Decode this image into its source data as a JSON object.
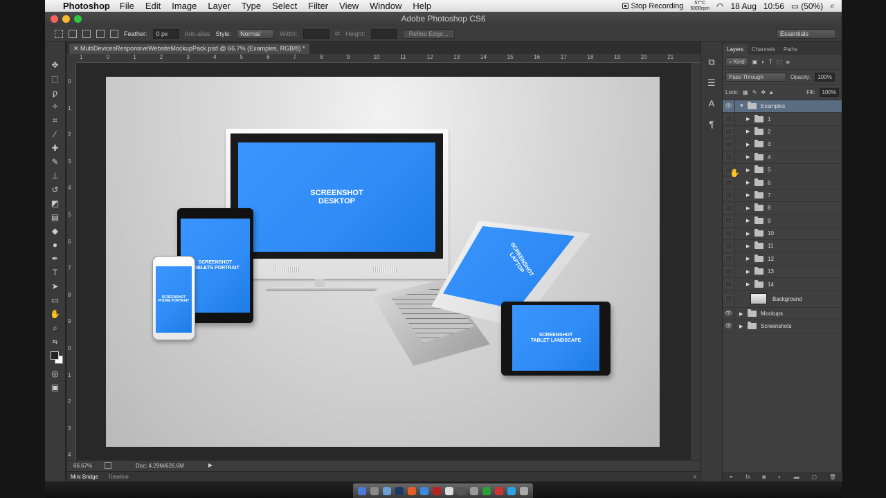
{
  "menubar": {
    "app_name": "Photoshop",
    "menus": [
      "File",
      "Edit",
      "Image",
      "Layer",
      "Type",
      "Select",
      "Filter",
      "View",
      "Window",
      "Help"
    ],
    "stop_recording": "Stop Recording",
    "temp_line1": "57°C",
    "temp_line2": "5000rpm",
    "date": "18 Aug",
    "time": "10:56",
    "battery": "(50%)"
  },
  "window": {
    "title": "Adobe Photoshop CS6"
  },
  "options_bar": {
    "feather_label": "Feather:",
    "feather_value": "0 px",
    "antialias_label": "Anti-alias",
    "style_label": "Style:",
    "style_value": "Normal",
    "width_label": "Width:",
    "height_label": "Height:",
    "refine_edge": "Refine Edge...",
    "workspace": "Essentials"
  },
  "document": {
    "tab_title": "MultiDevicesResponsiveWebsiteMockupPack.psd @ 66.7% (Examples, RGB/8) *",
    "ruler_top_labels": [
      "1",
      "0",
      "1",
      "2",
      "3",
      "4",
      "5",
      "6",
      "7",
      "8",
      "9",
      "10",
      "11",
      "12",
      "13",
      "14",
      "15",
      "16",
      "17",
      "18",
      "19",
      "20",
      "21"
    ],
    "ruler_left_labels": [
      "0",
      "1",
      "2",
      "3",
      "4",
      "5",
      "6",
      "7",
      "8",
      "9",
      "0",
      "1",
      "2",
      "3",
      "4"
    ]
  },
  "mockup": {
    "desktop_line1": "SCREENSHOT",
    "desktop_line2": "DESKTOP",
    "tablet_portrait_line1": "SCREENSHOT",
    "tablet_portrait_line2": "TABLETS PORTRAIT",
    "phone_line1": "SCREENSHOT",
    "phone_line2": "PHONE PORTRAIT",
    "laptop_line1": "SCREENSHOT",
    "laptop_line2": "LAPTOP",
    "tablet_landscape_line1": "SCREENSHOT",
    "tablet_landscape_line2": "TABLET LANDSCAPE"
  },
  "status": {
    "zoom": "66.67%",
    "doc_info": "Doc: 4.29M/626.6M"
  },
  "bottom_tabs": {
    "mini_bridge": "Mini Bridge",
    "timeline": "Timeline"
  },
  "layers_panel": {
    "tabs": [
      "Layers",
      "Channels",
      "Paths"
    ],
    "kind_label": "Kind",
    "blend_mode": "Pass Through",
    "opacity_label": "Opacity:",
    "opacity_value": "100%",
    "lock_label": "Lock:",
    "fill_label": "Fill:",
    "fill_value": "100%",
    "layers": [
      {
        "name": "Examples",
        "type": "group",
        "expanded": true,
        "visible": true,
        "selected": true,
        "indent": 0
      },
      {
        "name": "1",
        "type": "group",
        "visible": false,
        "indent": 1
      },
      {
        "name": "2",
        "type": "group",
        "visible": false,
        "indent": 1
      },
      {
        "name": "3",
        "type": "group",
        "visible": false,
        "indent": 1
      },
      {
        "name": "4",
        "type": "group",
        "visible": false,
        "indent": 1
      },
      {
        "name": "5",
        "type": "group",
        "visible": false,
        "indent": 1
      },
      {
        "name": "6",
        "type": "group",
        "visible": false,
        "indent": 1
      },
      {
        "name": "7",
        "type": "group",
        "visible": false,
        "indent": 1
      },
      {
        "name": "8",
        "type": "group",
        "visible": false,
        "indent": 1
      },
      {
        "name": "9",
        "type": "group",
        "visible": false,
        "indent": 1
      },
      {
        "name": "10",
        "type": "group",
        "visible": false,
        "indent": 1
      },
      {
        "name": "11",
        "type": "group",
        "visible": false,
        "indent": 1
      },
      {
        "name": "12",
        "type": "group",
        "visible": false,
        "indent": 1
      },
      {
        "name": "13",
        "type": "group",
        "visible": false,
        "indent": 1
      },
      {
        "name": "14",
        "type": "group",
        "visible": false,
        "indent": 1
      },
      {
        "name": "Background",
        "type": "pixel",
        "visible": false,
        "indent": 1
      },
      {
        "name": "Mockups",
        "type": "group",
        "visible": true,
        "indent": 0
      },
      {
        "name": "Screenshots",
        "type": "group",
        "visible": true,
        "indent": 0
      }
    ]
  },
  "colors": {
    "screen_blue": "#2f8bf5",
    "layer_selected": "#5a6d82",
    "panel_bg": "#404040"
  }
}
